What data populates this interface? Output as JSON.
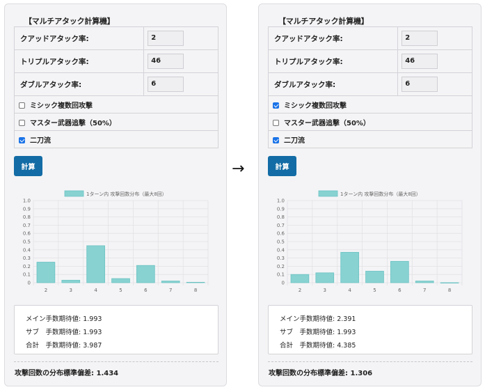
{
  "panels": [
    {
      "title": "【マルチアタック計算機】",
      "rows": [
        {
          "label": "クアッドアタック率:",
          "value": "2"
        },
        {
          "label": "トリプルアタック率:",
          "value": "46"
        },
        {
          "label": "ダブルアタック率:",
          "value": "6"
        }
      ],
      "options": [
        {
          "label": "ミシック複数回攻撃",
          "checked": false
        },
        {
          "label": "マスター武器追撃（50%）",
          "checked": false
        },
        {
          "label": "二刀流",
          "checked": true
        }
      ],
      "button_label": "計算",
      "results": [
        "メイン手数期待値: 1.993",
        "サブ　手数期待値: 1.993",
        "合計　手数期待値: 3.987"
      ],
      "stddev": "攻撃回数の分布標準偏差: 1.434"
    },
    {
      "title": "【マルチアタック計算機】",
      "rows": [
        {
          "label": "クアッドアタック率:",
          "value": "2"
        },
        {
          "label": "トリプルアタック率:",
          "value": "46"
        },
        {
          "label": "ダブルアタック率:",
          "value": "6"
        }
      ],
      "options": [
        {
          "label": "ミシック複数回攻撃",
          "checked": true
        },
        {
          "label": "マスター武器追撃（50%）",
          "checked": false
        },
        {
          "label": "二刀流",
          "checked": true
        }
      ],
      "button_label": "計算",
      "results": [
        "メイン手数期待値: 2.391",
        "サブ　手数期待値: 1.993",
        "合計　手数期待値: 4.385"
      ],
      "stddev": "攻撃回数の分布標準偏差: 1.306"
    }
  ],
  "arrow": "→",
  "chart_data": [
    {
      "type": "bar",
      "categories": [
        "2",
        "3",
        "4",
        "5",
        "6",
        "7",
        "8"
      ],
      "series": [
        {
          "name": "1ターン内 攻撃回数分布（最大8回）",
          "values": [
            0.25,
            0.03,
            0.45,
            0.05,
            0.21,
            0.02,
            0.005
          ]
        }
      ],
      "ylim": [
        0,
        1.0
      ],
      "yticks": [
        "0",
        "0.1",
        "0.2",
        "0.3",
        "0.4",
        "0.5",
        "0.6",
        "0.7",
        "0.8",
        "0.9",
        "1.0"
      ],
      "grid": true,
      "legend": "top",
      "color": "#88d2d2"
    },
    {
      "type": "bar",
      "categories": [
        "2",
        "3",
        "4",
        "5",
        "6",
        "7",
        "8"
      ],
      "series": [
        {
          "name": "1ターン内 攻撃回数分布（最大8回）",
          "values": [
            0.1,
            0.12,
            0.37,
            0.14,
            0.26,
            0.02,
            0.0
          ]
        }
      ],
      "ylim": [
        0,
        1.0
      ],
      "yticks": [
        "0",
        "0.1",
        "0.2",
        "0.3",
        "0.4",
        "0.5",
        "0.6",
        "0.7",
        "0.8",
        "0.9",
        "1.0"
      ],
      "grid": true,
      "legend": "top",
      "color": "#88d2d2"
    }
  ]
}
